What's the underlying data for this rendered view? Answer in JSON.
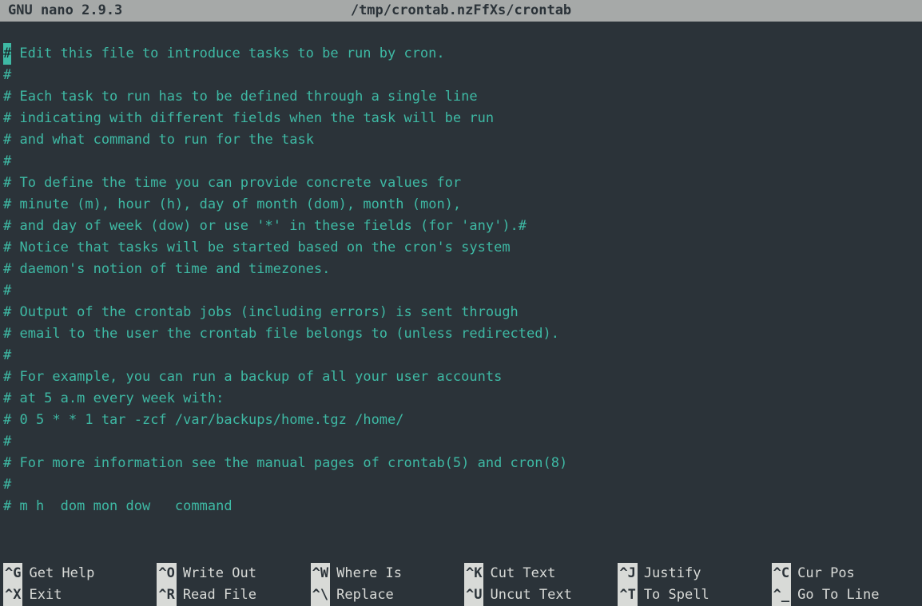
{
  "titlebar": {
    "app": "GNU nano 2.9.3",
    "file": "/tmp/crontab.nzFfXs/crontab"
  },
  "editor": {
    "cursor_char": "#",
    "lines": [
      " Edit this file to introduce tasks to be run by cron.",
      "#",
      "# Each task to run has to be defined through a single line",
      "# indicating with different fields when the task will be run",
      "# and what command to run for the task",
      "#",
      "# To define the time you can provide concrete values for",
      "# minute (m), hour (h), day of month (dom), month (mon),",
      "# and day of week (dow) or use '*' in these fields (for 'any').#",
      "# Notice that tasks will be started based on the cron's system",
      "# daemon's notion of time and timezones.",
      "#",
      "# Output of the crontab jobs (including errors) is sent through",
      "# email to the user the crontab file belongs to (unless redirected).",
      "#",
      "# For example, you can run a backup of all your user accounts",
      "# at 5 a.m every week with:",
      "# 0 5 * * 1 tar -zcf /var/backups/home.tgz /home/",
      "#",
      "# For more information see the manual pages of crontab(5) and cron(8)",
      "#",
      "# m h  dom mon dow   command"
    ]
  },
  "shortcuts": [
    {
      "key": "^G",
      "label": "Get Help"
    },
    {
      "key": "^O",
      "label": "Write Out"
    },
    {
      "key": "^W",
      "label": "Where Is"
    },
    {
      "key": "^K",
      "label": "Cut Text"
    },
    {
      "key": "^J",
      "label": "Justify"
    },
    {
      "key": "^C",
      "label": "Cur Pos"
    },
    {
      "key": "^X",
      "label": "Exit"
    },
    {
      "key": "^R",
      "label": "Read File"
    },
    {
      "key": "^\\",
      "label": "Replace"
    },
    {
      "key": "^U",
      "label": "Uncut Text"
    },
    {
      "key": "^T",
      "label": "To Spell"
    },
    {
      "key": "^_",
      "label": "Go To Line"
    }
  ]
}
